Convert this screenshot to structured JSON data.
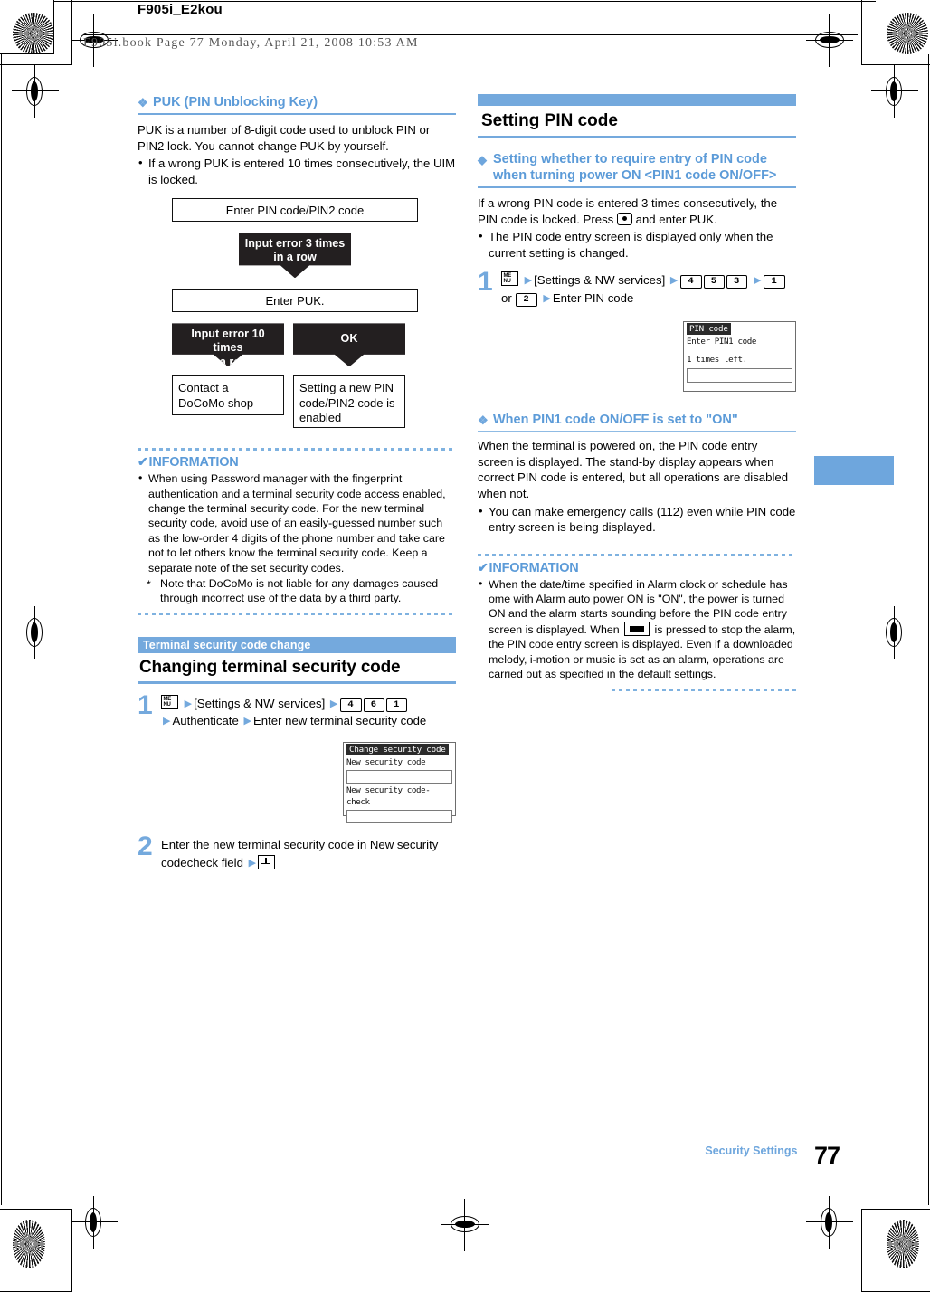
{
  "page": {
    "book_title": "F905i_E2kou",
    "book_line": "F905i.book  Page 77  Monday, April 21, 2008  10:53 AM",
    "footer_label": "Security Settings",
    "footer_page": "77",
    "accent_blue": "#74a9dd",
    "dark_fill": "#231f20"
  },
  "left": {
    "puk": {
      "heading": "PUK (PIN Unblocking Key)",
      "paragraph": "PUK is a number of 8-digit code used to unblock PIN or PIN2 lock. You cannot change PUK by yourself.",
      "bullets": [
        "If a wrong PUK is entered 10 times consecutively, the UIM is locked."
      ]
    },
    "flow": {
      "box_enter_pin": "Enter PIN code/PIN2 code",
      "arrow_error3_l1": "Input error 3 times",
      "arrow_error3_l2": "in a row",
      "box_enter_puk": "Enter PUK.",
      "arrow_error10_l1": "Input error 10 times",
      "arrow_error10_l2": "in a row",
      "arrow_ok": "OK",
      "box_contact": "Contact a DoCoMo shop",
      "box_setting_new": "Setting a new PIN code/PIN2 code is enabled"
    },
    "information": {
      "title": "INFORMATION",
      "bullets": [
        "When using Password manager with the fingerprint authentication and a terminal security code access enabled, change the terminal security code. For the new terminal security code, avoid use of an easily-guessed number such as the low-order 4 digits of the phone number and take care not to let others know the terminal security code. Keep a separate note of the set security codes."
      ],
      "note": "Note that DoCoMo is not liable for any damages caused through incorrect use of the data by a third party."
    },
    "security_change": {
      "tab": "Terminal security code change",
      "title": "Changing terminal security code",
      "step1": {
        "num": "1",
        "menu_icon": "menu-key-icon",
        "menu_glyph_top": "ME",
        "menu_glyph_bottom": "NU",
        "text_a": "[Settings & NW services]",
        "keys": [
          "4",
          "6",
          "1"
        ],
        "text_b": "Authenticate",
        "text_c": "Enter new terminal security code"
      },
      "screen": {
        "title": "Change security code",
        "line1": "New security code",
        "line2": "New security code-check"
      },
      "step2": {
        "num": "2",
        "text_a": "Enter the new terminal security code in New security codecheck field",
        "key_icon": "book-key-icon"
      }
    }
  },
  "right": {
    "section": {
      "title": "Setting PIN code"
    },
    "pin1": {
      "heading": "Setting whether to require entry of PIN code when turning power ON <PIN1 code ON/OFF>",
      "paragraph_a": "If a wrong PIN code is entered 3 times consecutively, the PIN code is locked. Press",
      "paragraph_b": "and enter PUK.",
      "bullets": [
        "The PIN code entry screen is displayed only when the current setting is changed."
      ],
      "step1": {
        "num": "1",
        "menu_glyph_top": "ME",
        "menu_glyph_bottom": "NU",
        "text_a": "[Settings & NW services]",
        "keys": [
          "4",
          "5",
          "3"
        ],
        "key_opt1": "1",
        "or_text": "or",
        "key_opt2": "2",
        "text_b": "Enter PIN code"
      },
      "screen": {
        "title": "PIN code",
        "line1": "Enter PIN1 code",
        "line2": "1 times left."
      }
    },
    "pin1_on": {
      "heading": "When PIN1 code ON/OFF is set to \"ON\"",
      "paragraph": "When the terminal is powered on, the PIN code entry screen is displayed. The stand-by display appears when correct PIN code is entered, but all operations are disabled when not.",
      "bullets": [
        "You can make emergency calls (112) even while PIN code entry screen is being displayed."
      ]
    },
    "information": {
      "title": "INFORMATION",
      "bullet_a": "When the date/time specified in Alarm clock or schedule has ome with Alarm auto power ON is \"ON\", the power is turned ON and the alarm starts sounding before the PIN code entry screen is displayed. When",
      "bullet_b": "is pressed to stop the alarm, the PIN code entry screen is displayed. Even if a downloaded melody, i-motion or music is set as an alarm, operations are carried out as specified in the default settings."
    }
  }
}
